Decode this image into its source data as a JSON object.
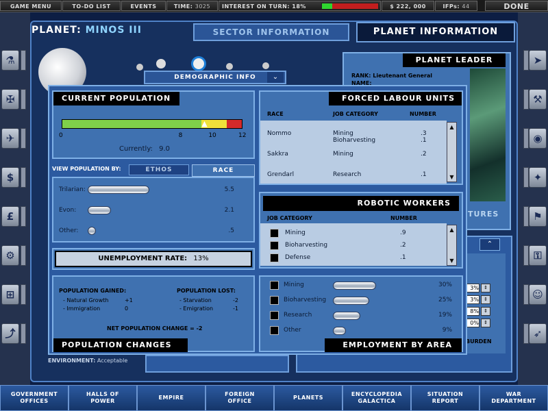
{
  "topbar": {
    "game_menu": "GAME MENU",
    "todo": "TO-DO LIST",
    "events": "EVENTS",
    "time_label": "TIME:",
    "time_value": "3025",
    "interest_label": "INTEREST ON TURN: 18%",
    "interest_fraction": 0.18,
    "credits": "$ 222, 000",
    "ifps_label": "IFPs:",
    "ifps_value": "44",
    "done": "DONE"
  },
  "header": {
    "planet_label": "PLANET:",
    "planet_name": "MINOS III",
    "sector_tab": "SECTOR INFORMATION",
    "planet_tab": "PLANET INFORMATION"
  },
  "leader": {
    "title": "PLANET LEADER",
    "rank_label": "RANK: Lieutenant General",
    "name_label": "NAME:"
  },
  "demographic": {
    "tab": "DEMOGRAPHIC INFO"
  },
  "population": {
    "title": "CURRENT POPULATION",
    "bar_max": 12,
    "bar_current": 9.0,
    "bar_warn_start": 9.5,
    "bar_red_start": 11,
    "ticks": [
      "0",
      "8",
      "10",
      "12"
    ],
    "currently_label": "Currently:",
    "currently_value": "9.0"
  },
  "view_by": {
    "label": "VIEW POPULATION BY:",
    "tab_ethos": "ETHOS",
    "tab_race": "RACE",
    "rows": [
      {
        "name": "Trilarian:",
        "value": "5.5",
        "fraction": 0.61
      },
      {
        "name": "Evon:",
        "value": "2.1",
        "fraction": 0.23
      },
      {
        "name": "Other:",
        "value": ".5",
        "fraction": 0.06
      }
    ]
  },
  "unemployment": {
    "label": "UNEMPLOYMENT RATE:",
    "value": "13%"
  },
  "changes": {
    "gained_title": "POPULATION GAINED:",
    "gained": [
      {
        "label": "- Natural Growth",
        "value": "+1"
      },
      {
        "label": "- Immigration",
        "value": "0"
      }
    ],
    "lost_title": "POPULATION LOST:",
    "lost": [
      {
        "label": "- Starvation",
        "value": "-2"
      },
      {
        "label": "- Emigration",
        "value": "-1"
      }
    ],
    "net_label": "NET POPULATION CHANGE = -2",
    "footer": "POPULATION CHANGES"
  },
  "forced": {
    "title": "FORCED LABOUR UNITS",
    "headers": [
      "RACE",
      "JOB CATEGORY",
      "NUMBER"
    ],
    "rows": [
      {
        "race": "Nommo",
        "job": "Mining",
        "num": ".3"
      },
      {
        "race": "",
        "job": "Bioharvesting",
        "num": ".1"
      },
      {
        "race": "Sakkra",
        "job": "Mining",
        "num": ".2"
      },
      {
        "race": "Grendarl",
        "job": "Research",
        "num": ".1"
      }
    ]
  },
  "robotic": {
    "title": "ROBOTIC WORKERS",
    "headers": [
      "JOB CATEGORY",
      "NUMBER"
    ],
    "rows": [
      {
        "job": "Mining",
        "num": ".9"
      },
      {
        "job": "Bioharvesting",
        "num": ".2"
      },
      {
        "job": "Defense",
        "num": ".1"
      }
    ]
  },
  "employment": {
    "footer": "EMPLOYMENT BY AREA",
    "rows": [
      {
        "name": "Mining",
        "value": "30%",
        "fraction": 0.3
      },
      {
        "name": "Bioharvesting",
        "value": "25%",
        "fraction": 0.25
      },
      {
        "name": "Research",
        "value": "19%",
        "fraction": 0.19
      },
      {
        "name": "Other",
        "value": "9%",
        "fraction": 0.09
      }
    ]
  },
  "behind": {
    "tures": "TURES",
    "burden": "BURDEN",
    "pcts": [
      "3%",
      "3%",
      "8%",
      "0%"
    ],
    "environment_label": "ENVIRONMENT:",
    "environment_value": "Acceptable"
  },
  "bottom": [
    "GOVERNMENT OFFICES",
    "HALLS OF POWER",
    "EMPIRE",
    "FOREIGN OFFICE",
    "PLANETS",
    "ENCYCLOPEDIA GALACTICA",
    "SITUATION REPORT",
    "WAR DEPARTMENT"
  ],
  "colors": {
    "panel": "#3f71b0",
    "bar_green": "#7fd04a",
    "bar_yellow": "#f0e13a",
    "bar_red": "#d42a2a"
  }
}
